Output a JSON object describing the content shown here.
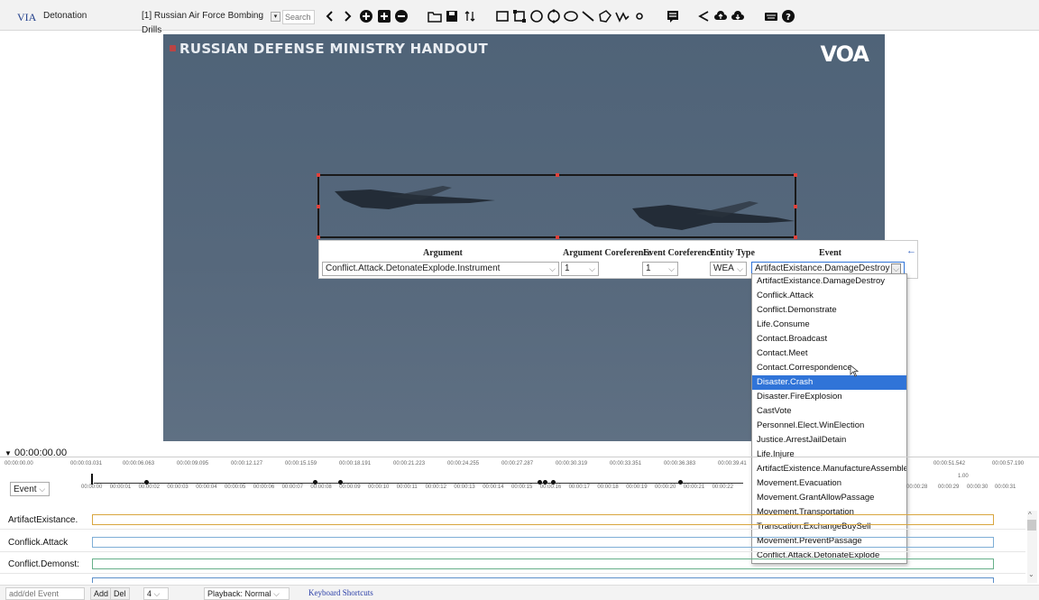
{
  "topbar": {
    "app_name": "VIA",
    "project_name": "Detonation",
    "video_selector": "[1] Russian Air Force Bombing Drills",
    "search_placeholder": "Search"
  },
  "video": {
    "caption": "RUSSIAN DEFENSE MINISTRY HANDOUT",
    "logo": "VOA"
  },
  "annotation": {
    "headers": [
      "Argument",
      "Argument Coreference",
      "Event Coreference",
      "Entity Type",
      "Event"
    ],
    "argument_value": "Conflict.Attack.DetonateExplode.Instrument",
    "argument_coref": "1",
    "event_coref": "1",
    "entity_type": "WEA",
    "event_value": "ArtifactExistance.DamageDestroy",
    "back_arrow": "←"
  },
  "dropdown": {
    "options": [
      "ArtifactExistance.DamageDestroy",
      "Conflick.Attack",
      "Conflict.Demonstrate",
      "Life.Consume",
      "Contact.Broadcast",
      "Contact.Meet",
      "Contact.Correspondence",
      "Disaster.Crash",
      "Disaster.FireExplosion",
      "CastVote",
      "Personnel.Elect.WinElection",
      "Justice.ArrestJailDetain",
      "Life.Injure",
      "ArtifactExistence.ManufactureAssemble",
      "Movement.Evacuation",
      "Movement.GrantAllowPassage",
      "Movement.Transportation",
      "Transcation.ExchangeBuySell",
      "Movement.PreventPassage",
      "Conflict.Attack.DetonateExplode"
    ],
    "highlighted": "Disaster.Crash"
  },
  "timeline": {
    "current_time": "00:00:00.00",
    "ruler_labels": [
      "00:00:00.00",
      "00:00:03.031",
      "00:00:06.063",
      "00:00:09.095",
      "00:00:12.127",
      "00:00:15.159",
      "00:00:18.191",
      "00:00:21.223",
      "00:00:24.255",
      "00:00:27.287",
      "00:00:30.319",
      "00:00:33.351",
      "00:00:36.383",
      "00:00:39.41",
      "00:00:51.542",
      "00:00:57.190"
    ],
    "mini_labels": [
      "00:00:00",
      "00:00:01",
      "00:00:02",
      "00:00:03",
      "00:00:04",
      "00:00:05",
      "00:00:06",
      "00:00:07",
      "00:00:08",
      "00:00:09",
      "00:00:10",
      "00:00:11",
      "00:00:12",
      "00:00:13",
      "00:00:14",
      "00:00:15",
      "00:00:16",
      "00:00:17",
      "00:00:18",
      "00:00:19",
      "00:00:20",
      "00:00:21",
      "00:00:22",
      "00:00:28",
      "00:00:29",
      "00:00:30",
      "00:00:31"
    ],
    "right_marker": "1.00",
    "track_select": "Event",
    "rows": [
      {
        "label": "ArtifactExistance.",
        "color": "#d9a63f"
      },
      {
        "label": "Conflick.Attack",
        "color": "#7eaed6"
      },
      {
        "label": "Conflict.Demonst:",
        "color": "#67b08a"
      }
    ]
  },
  "bottombar": {
    "add_del_placeholder": "add/del Event",
    "add_label": "Add",
    "del_label": "Del",
    "count_value": "4",
    "playback_value": "Playback: Normal",
    "shortcuts_label": "Keyboard Shortcuts"
  }
}
